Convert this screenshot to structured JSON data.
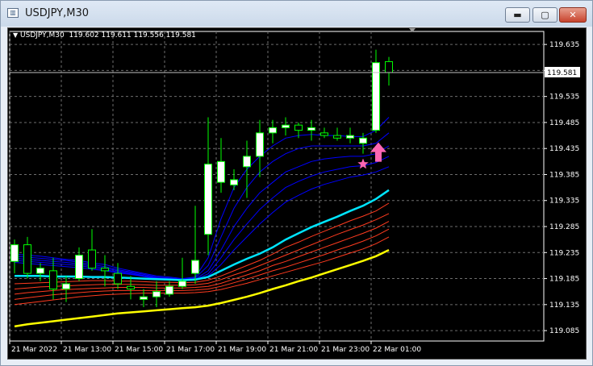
{
  "window": {
    "title": "USDJPY,M30",
    "app_icon": "chart-window-icon",
    "buttons": {
      "minimize": "minimize-icon",
      "maximize": "maximize-icon",
      "close": "close-icon"
    }
  },
  "chart": {
    "info_line": "USDJPY,M30  119.602 119.611 119.556 119.581",
    "current_price_label": "119.581",
    "colors": {
      "background": "#000000",
      "grid": "#6e6e6e",
      "bull_candle": "#ffffff",
      "bear_candle": "#000000",
      "candle_outline": "#00ff00",
      "fast_mas": "#0000ff",
      "mid_ma": "#00e5ff",
      "slow_mas": "#ff3b1f",
      "ma_slowest": "#ffff00",
      "arrow": "#ff66b3",
      "star": "#ff66b3"
    },
    "icons": [
      "pink-up-arrow-icon",
      "pink-star-icon"
    ]
  },
  "chart_data": {
    "type": "candlestick",
    "symbol": "USDJPY",
    "timeframe": "M30",
    "y_ticks": [
      "119.635",
      "119.585",
      "119.535",
      "119.485",
      "119.435",
      "119.385",
      "119.335",
      "119.285",
      "119.235",
      "119.185",
      "119.135",
      "119.085"
    ],
    "x_ticks": [
      "21 Mar 2022",
      "21 Mar 13:00",
      "21 Mar 15:00",
      "21 Mar 17:00",
      "21 Mar 19:00",
      "21 Mar 21:00",
      "21 Mar 23:00",
      "22 Mar 01:00"
    ],
    "ylim": [
      119.065,
      119.66
    ],
    "candles": [
      {
        "o": 119.218,
        "h": 119.26,
        "l": 119.195,
        "c": 119.25
      },
      {
        "o": 119.25,
        "h": 119.265,
        "l": 119.185,
        "c": 119.195
      },
      {
        "o": 119.195,
        "h": 119.215,
        "l": 119.18,
        "c": 119.205
      },
      {
        "o": 119.2,
        "h": 119.225,
        "l": 119.145,
        "c": 119.165
      },
      {
        "o": 119.165,
        "h": 119.19,
        "l": 119.14,
        "c": 119.175
      },
      {
        "o": 119.185,
        "h": 119.245,
        "l": 119.18,
        "c": 119.23
      },
      {
        "o": 119.24,
        "h": 119.28,
        "l": 119.2,
        "c": 119.205
      },
      {
        "o": 119.205,
        "h": 119.23,
        "l": 119.17,
        "c": 119.2
      },
      {
        "o": 119.195,
        "h": 119.215,
        "l": 119.165,
        "c": 119.175
      },
      {
        "o": 119.17,
        "h": 119.19,
        "l": 119.145,
        "c": 119.165
      },
      {
        "o": 119.145,
        "h": 119.165,
        "l": 119.13,
        "c": 119.15
      },
      {
        "o": 119.15,
        "h": 119.18,
        "l": 119.13,
        "c": 119.16
      },
      {
        "o": 119.155,
        "h": 119.18,
        "l": 119.15,
        "c": 119.17
      },
      {
        "o": 119.17,
        "h": 119.225,
        "l": 119.165,
        "c": 119.18
      },
      {
        "o": 119.195,
        "h": 119.325,
        "l": 119.175,
        "c": 119.22
      },
      {
        "o": 119.27,
        "h": 119.495,
        "l": 119.23,
        "c": 119.405
      },
      {
        "o": 119.37,
        "h": 119.455,
        "l": 119.35,
        "c": 119.41
      },
      {
        "o": 119.365,
        "h": 119.395,
        "l": 119.355,
        "c": 119.375
      },
      {
        "o": 119.4,
        "h": 119.45,
        "l": 119.34,
        "c": 119.42
      },
      {
        "o": 119.42,
        "h": 119.49,
        "l": 119.38,
        "c": 119.465
      },
      {
        "o": 119.465,
        "h": 119.49,
        "l": 119.445,
        "c": 119.475
      },
      {
        "o": 119.475,
        "h": 119.495,
        "l": 119.46,
        "c": 119.48
      },
      {
        "o": 119.48,
        "h": 119.485,
        "l": 119.455,
        "c": 119.47
      },
      {
        "o": 119.47,
        "h": 119.49,
        "l": 119.45,
        "c": 119.475
      },
      {
        "o": 119.465,
        "h": 119.475,
        "l": 119.455,
        "c": 119.46
      },
      {
        "o": 119.46,
        "h": 119.475,
        "l": 119.45,
        "c": 119.455
      },
      {
        "o": 119.455,
        "h": 119.475,
        "l": 119.445,
        "c": 119.46
      },
      {
        "o": 119.445,
        "h": 119.465,
        "l": 119.425,
        "c": 119.455
      },
      {
        "o": 119.47,
        "h": 119.625,
        "l": 119.465,
        "c": 119.6
      },
      {
        "o": 119.602,
        "h": 119.611,
        "l": 119.556,
        "c": 119.581
      }
    ],
    "mas": [
      {
        "name": "",
        "color": "#0000ff",
        "values": [
          119.232,
          119.23,
          119.228,
          119.225,
          119.222,
          119.22,
          119.215,
          119.212,
          119.205,
          119.2,
          119.195,
          119.19,
          119.188,
          119.185,
          119.188,
          119.225,
          119.3,
          119.36,
          119.395,
          119.42,
          119.44,
          119.455,
          119.46,
          119.462,
          119.46,
          119.46,
          119.458,
          119.458,
          119.47,
          119.495
        ]
      },
      {
        "name": "",
        "color": "#0000ff",
        "values": [
          119.228,
          119.226,
          119.224,
          119.222,
          119.22,
          119.216,
          119.212,
          119.208,
          119.202,
          119.198,
          119.193,
          119.188,
          119.186,
          119.184,
          119.186,
          119.21,
          119.265,
          119.32,
          119.36,
          119.39,
          119.41,
          119.425,
          119.435,
          119.44,
          119.44,
          119.44,
          119.44,
          119.44,
          119.445,
          119.465
        ]
      },
      {
        "name": "",
        "color": "#0000ff",
        "values": [
          119.224,
          119.222,
          119.22,
          119.218,
          119.216,
          119.213,
          119.209,
          119.205,
          119.2,
          119.196,
          119.191,
          119.187,
          119.185,
          119.183,
          119.184,
          119.2,
          119.24,
          119.285,
          119.32,
          119.35,
          119.37,
          119.39,
          119.4,
          119.41,
          119.415,
          119.418,
          119.42,
          119.42,
          119.425,
          119.44
        ]
      },
      {
        "name": "",
        "color": "#0000ff",
        "values": [
          119.22,
          119.218,
          119.216,
          119.214,
          119.212,
          119.21,
          119.206,
          119.202,
          119.198,
          119.194,
          119.19,
          119.186,
          119.184,
          119.182,
          119.183,
          119.194,
          119.225,
          119.26,
          119.29,
          119.318,
          119.34,
          119.36,
          119.372,
          119.382,
          119.39,
          119.395,
          119.4,
          119.402,
          119.408,
          119.42
        ]
      },
      {
        "name": "",
        "color": "#0000ff",
        "values": [
          119.216,
          119.214,
          119.212,
          119.21,
          119.208,
          119.206,
          119.203,
          119.2,
          119.196,
          119.193,
          119.189,
          119.185,
          119.183,
          119.181,
          119.182,
          119.19,
          119.212,
          119.24,
          119.265,
          119.29,
          119.312,
          119.332,
          119.345,
          119.357,
          119.366,
          119.373,
          119.38,
          119.384,
          119.39,
          119.4
        ]
      },
      {
        "name": "",
        "color": "#00e5ff",
        "values": [
          119.19,
          119.19,
          119.19,
          119.189,
          119.189,
          119.189,
          119.188,
          119.188,
          119.187,
          119.186,
          119.185,
          119.184,
          119.183,
          119.182,
          119.183,
          119.188,
          119.2,
          119.212,
          119.223,
          119.233,
          119.245,
          119.26,
          119.272,
          119.284,
          119.294,
          119.304,
          119.315,
          119.325,
          119.338,
          119.355
        ]
      },
      {
        "name": "",
        "color": "#ff3b1f",
        "values": [
          119.175,
          119.176,
          119.177,
          119.178,
          119.179,
          119.18,
          119.181,
          119.181,
          119.18,
          119.18,
          119.179,
          119.178,
          119.178,
          119.177,
          119.178,
          119.182,
          119.19,
          119.2,
          119.21,
          119.22,
          119.232,
          119.245,
          119.255,
          119.266,
          119.276,
          119.286,
          119.296,
          119.305,
          119.315,
          119.33
        ]
      },
      {
        "name": "",
        "color": "#ff3b1f",
        "values": [
          119.165,
          119.167,
          119.169,
          119.17,
          119.171,
          119.172,
          119.173,
          119.174,
          119.174,
          119.174,
          119.173,
          119.172,
          119.172,
          119.172,
          119.173,
          119.176,
          119.183,
          119.192,
          119.2,
          119.21,
          119.22,
          119.23,
          119.24,
          119.25,
          119.26,
          119.27,
          119.279,
          119.288,
          119.298,
          119.31
        ]
      },
      {
        "name": "",
        "color": "#ff3b1f",
        "values": [
          119.155,
          119.158,
          119.16,
          119.162,
          119.164,
          119.165,
          119.166,
          119.167,
          119.168,
          119.168,
          119.168,
          119.167,
          119.167,
          119.167,
          119.168,
          119.17,
          119.176,
          119.184,
          119.192,
          119.2,
          119.21,
          119.218,
          119.227,
          119.236,
          119.245,
          119.254,
          119.263,
          119.272,
          119.282,
          119.295
        ]
      },
      {
        "name": "",
        "color": "#ff3b1f",
        "values": [
          119.145,
          119.148,
          119.151,
          119.154,
          119.156,
          119.158,
          119.16,
          119.161,
          119.162,
          119.162,
          119.162,
          119.162,
          119.162,
          119.162,
          119.163,
          119.165,
          119.17,
          119.177,
          119.184,
          119.192,
          119.2,
          119.207,
          119.215,
          119.223,
          119.231,
          119.24,
          119.248,
          119.257,
          119.267,
          119.28
        ]
      },
      {
        "name": "",
        "color": "#ff3b1f",
        "values": [
          119.135,
          119.138,
          119.141,
          119.144,
          119.147,
          119.15,
          119.152,
          119.154,
          119.155,
          119.156,
          119.157,
          119.157,
          119.157,
          119.157,
          119.158,
          119.16,
          119.164,
          119.17,
          119.176,
          119.183,
          119.19,
          119.197,
          119.204,
          119.211,
          119.218,
          119.226,
          119.234,
          119.242,
          119.252,
          119.265
        ]
      },
      {
        "name": "",
        "color": "#ffff00",
        "values": [
          119.093,
          119.097,
          119.1,
          119.103,
          119.106,
          119.109,
          119.112,
          119.115,
          119.118,
          119.12,
          119.122,
          119.124,
          119.126,
          119.128,
          119.13,
          119.133,
          119.138,
          119.144,
          119.15,
          119.157,
          119.165,
          119.172,
          119.18,
          119.187,
          119.195,
          119.203,
          119.211,
          119.219,
          119.228,
          119.24
        ]
      }
    ],
    "markers": [
      {
        "type": "arrow-up",
        "candle": 28,
        "price": 119.425,
        "color": "#ff66b3"
      },
      {
        "type": "star",
        "candle": 27,
        "price": 119.405,
        "color": "#ff66b3"
      }
    ]
  }
}
